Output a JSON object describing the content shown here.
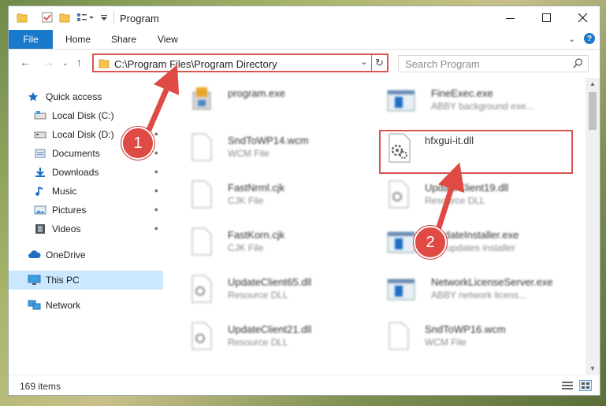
{
  "window": {
    "title": "Program"
  },
  "ribbon": {
    "file_tab": "File",
    "tabs": [
      "Home",
      "Share",
      "View"
    ]
  },
  "address": {
    "path": "C:\\Program Files\\Program Directory",
    "search_placeholder": "Search Program"
  },
  "sidebar": {
    "items": [
      {
        "label": "Quick access",
        "icon": "star-icon"
      },
      {
        "label": "Local Disk (C:)",
        "icon": "drive-icon",
        "pinned": true
      },
      {
        "label": "Local Disk (D:)",
        "icon": "drive-icon",
        "pinned": true
      },
      {
        "label": "Documents",
        "icon": "documents-icon",
        "pinned": true
      },
      {
        "label": "Downloads",
        "icon": "download-icon",
        "pinned": true
      },
      {
        "label": "Music",
        "icon": "music-icon",
        "pinned": true
      },
      {
        "label": "Pictures",
        "icon": "pictures-icon",
        "pinned": true
      },
      {
        "label": "Videos",
        "icon": "videos-icon",
        "pinned": true
      },
      {
        "label": "OneDrive",
        "icon": "cloud-icon"
      },
      {
        "label": "This PC",
        "icon": "computer-icon",
        "selected": true
      },
      {
        "label": "Network",
        "icon": "network-icon"
      }
    ]
  },
  "files": [
    {
      "name": "program.exe",
      "type": "",
      "icon": "setup-exe-icon"
    },
    {
      "name": "FineExec.exe",
      "type": "ABBY background exe...",
      "icon": "app-window-icon"
    },
    {
      "name": "SndToWP14.wcm",
      "type": "WCM File",
      "icon": "blank-file-icon"
    },
    {
      "name": "hfxgui-it.dll",
      "type": "",
      "icon": "dll-gear-icon",
      "highlighted": true
    },
    {
      "name": "FastNrml.cjk",
      "type": "CJK File",
      "icon": "blank-file-icon"
    },
    {
      "name": "UpdateClient19.dll",
      "type": "Resource DLL",
      "icon": "dll-gear-icon"
    },
    {
      "name": "FastKorn.cjk",
      "type": "CJK File",
      "icon": "blank-file-icon"
    },
    {
      "name": "UpdateInstaller.exe",
      "type": "...s updates installer",
      "icon": "app-window-icon"
    },
    {
      "name": "UpdateClient65.dll",
      "type": "Resource DLL",
      "icon": "dll-gear-icon"
    },
    {
      "name": "NetworkLicenseServer.exe",
      "type": "ABBY network licens...",
      "icon": "app-window-icon"
    },
    {
      "name": "UpdateClient21.dll",
      "type": "Resource DLL",
      "icon": "dll-gear-icon"
    },
    {
      "name": "SndToWP16.wcm",
      "type": "WCM File",
      "icon": "blank-file-icon"
    }
  ],
  "status": {
    "item_count": "169 items"
  },
  "annotations": {
    "step1": "1",
    "step2": "2"
  },
  "colors": {
    "accent": "#1979ca",
    "highlight": "#d9534f",
    "selected": "#cce8ff"
  }
}
